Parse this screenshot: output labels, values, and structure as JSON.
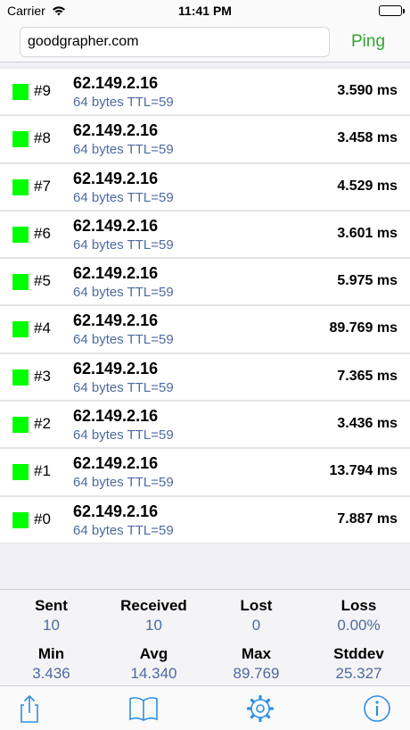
{
  "status_bar": {
    "carrier": "Carrier",
    "time": "11:41 PM"
  },
  "search": {
    "value": "goodgrapher.com",
    "ping_label": "Ping"
  },
  "rows": [
    {
      "seq": "#9",
      "host": "62.149.2.16",
      "detail": "64 bytes TTL=59",
      "time": "3.590 ms"
    },
    {
      "seq": "#8",
      "host": "62.149.2.16",
      "detail": "64 bytes TTL=59",
      "time": "3.458 ms"
    },
    {
      "seq": "#7",
      "host": "62.149.2.16",
      "detail": "64 bytes TTL=59",
      "time": "4.529 ms"
    },
    {
      "seq": "#6",
      "host": "62.149.2.16",
      "detail": "64 bytes TTL=59",
      "time": "3.601 ms"
    },
    {
      "seq": "#5",
      "host": "62.149.2.16",
      "detail": "64 bytes TTL=59",
      "time": "5.975 ms"
    },
    {
      "seq": "#4",
      "host": "62.149.2.16",
      "detail": "64 bytes TTL=59",
      "time": "89.769 ms"
    },
    {
      "seq": "#3",
      "host": "62.149.2.16",
      "detail": "64 bytes TTL=59",
      "time": "7.365 ms"
    },
    {
      "seq": "#2",
      "host": "62.149.2.16",
      "detail": "64 bytes TTL=59",
      "time": "3.436 ms"
    },
    {
      "seq": "#1",
      "host": "62.149.2.16",
      "detail": "64 bytes TTL=59",
      "time": "13.794 ms"
    },
    {
      "seq": "#0",
      "host": "62.149.2.16",
      "detail": "64 bytes TTL=59",
      "time": "7.887 ms"
    }
  ],
  "stats": {
    "sent": {
      "label": "Sent",
      "value": "10"
    },
    "received": {
      "label": "Received",
      "value": "10"
    },
    "lost": {
      "label": "Lost",
      "value": "0"
    },
    "loss": {
      "label": "Loss",
      "value": "0.00%"
    },
    "min": {
      "label": "Min",
      "value": "3.436"
    },
    "avg": {
      "label": "Avg",
      "value": "14.340"
    },
    "max": {
      "label": "Max",
      "value": "89.769"
    },
    "stddev": {
      "label": "Stddev",
      "value": "25.327"
    }
  },
  "colors": {
    "accent": "#2f8ee3",
    "ping_green": "#2fa52f",
    "status_ok": "#00ff00",
    "value_blue": "#4d6aa1"
  },
  "icons": {
    "share": "share-icon",
    "bookmarks": "book-icon",
    "settings": "gear-icon",
    "info": "info-icon"
  }
}
